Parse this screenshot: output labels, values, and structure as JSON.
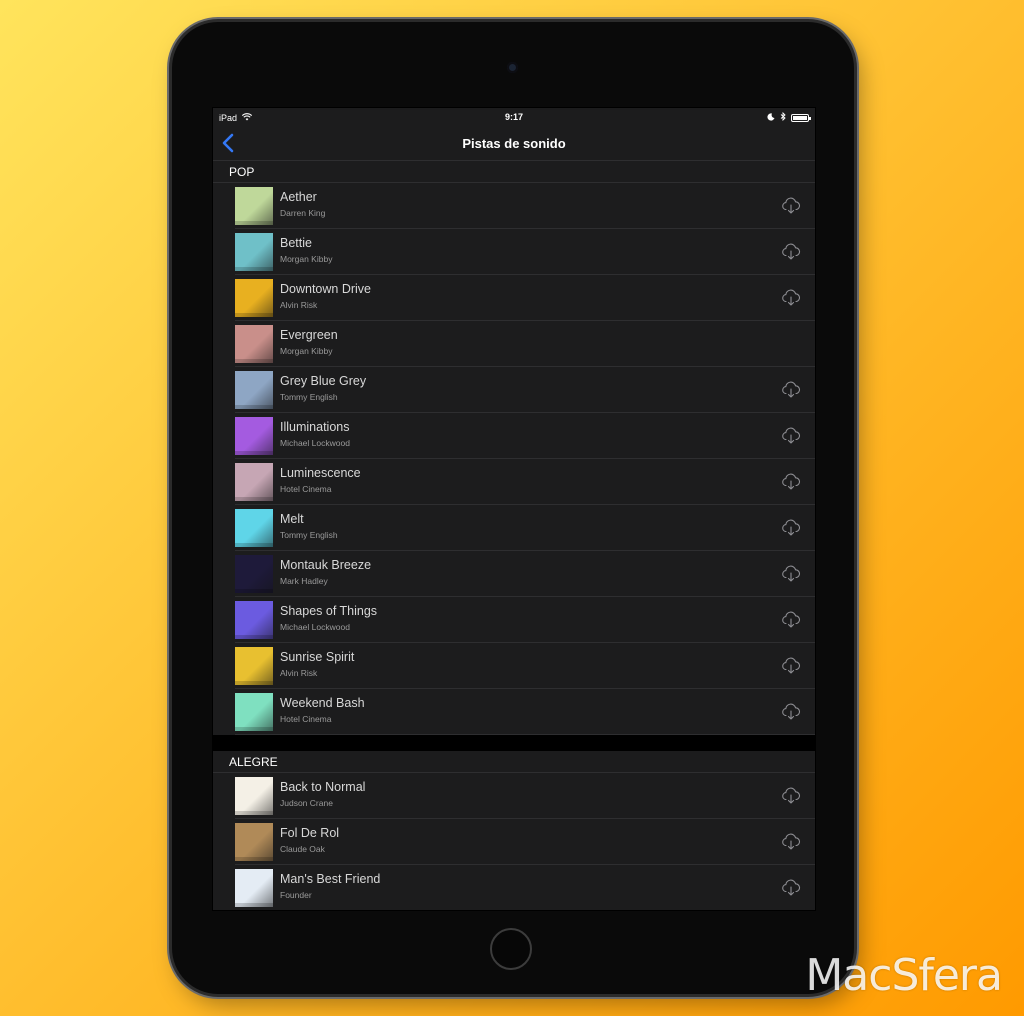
{
  "status_bar": {
    "device": "iPad",
    "time": "9:17"
  },
  "nav": {
    "title": "Pistas de sonido"
  },
  "sections": [
    {
      "header": "POP",
      "tracks": [
        {
          "title": "Aether",
          "artist": "Darren King",
          "downloadable": true,
          "art": "#bfd89a"
        },
        {
          "title": "Bettie",
          "artist": "Morgan Kibby",
          "downloadable": true,
          "art": "#6fc0c8"
        },
        {
          "title": "Downtown Drive",
          "artist": "Alvin Risk",
          "downloadable": true,
          "art": "#e8b020"
        },
        {
          "title": "Evergreen",
          "artist": "Morgan Kibby",
          "downloadable": false,
          "art": "#c98f8a"
        },
        {
          "title": "Grey Blue Grey",
          "artist": "Tommy English",
          "downloadable": true,
          "art": "#8ea6c4"
        },
        {
          "title": "Illuminations",
          "artist": "Michael Lockwood",
          "downloadable": true,
          "art": "#a45be0"
        },
        {
          "title": "Luminescence",
          "artist": "Hotel Cinema",
          "downloadable": true,
          "art": "#c6a6b4"
        },
        {
          "title": "Melt",
          "artist": "Tommy English",
          "downloadable": true,
          "art": "#5fd5e8"
        },
        {
          "title": "Montauk Breeze",
          "artist": "Mark Hadley",
          "downloadable": true,
          "art": "#1e1a3a"
        },
        {
          "title": "Shapes of Things",
          "artist": "Michael Lockwood",
          "downloadable": true,
          "art": "#6b5be0"
        },
        {
          "title": "Sunrise Spirit",
          "artist": "Alvin Risk",
          "downloadable": true,
          "art": "#e8c030"
        },
        {
          "title": "Weekend Bash",
          "artist": "Hotel Cinema",
          "downloadable": true,
          "art": "#7fe0c0"
        }
      ]
    },
    {
      "header": "ALEGRE",
      "tracks": [
        {
          "title": "Back to Normal",
          "artist": "Judson Crane",
          "downloadable": true,
          "art": "#f4f0e6"
        },
        {
          "title": "Fol De Rol",
          "artist": "Claude Oak",
          "downloadable": true,
          "art": "#b08a58"
        },
        {
          "title": "Man's Best Friend",
          "artist": "Founder",
          "downloadable": true,
          "art": "#e4ecf4"
        }
      ]
    }
  ],
  "watermark": "MacSfera",
  "colors": {
    "accent": "#3478f6",
    "screen_bg": "#1c1c1d",
    "separator": "#2e2e30"
  },
  "icons": {
    "back": "chevron-left-icon",
    "download": "cloud-download-icon",
    "wifi": "wifi-icon",
    "moon": "moon-icon",
    "bluetooth": "bluetooth-icon",
    "battery": "battery-icon"
  }
}
